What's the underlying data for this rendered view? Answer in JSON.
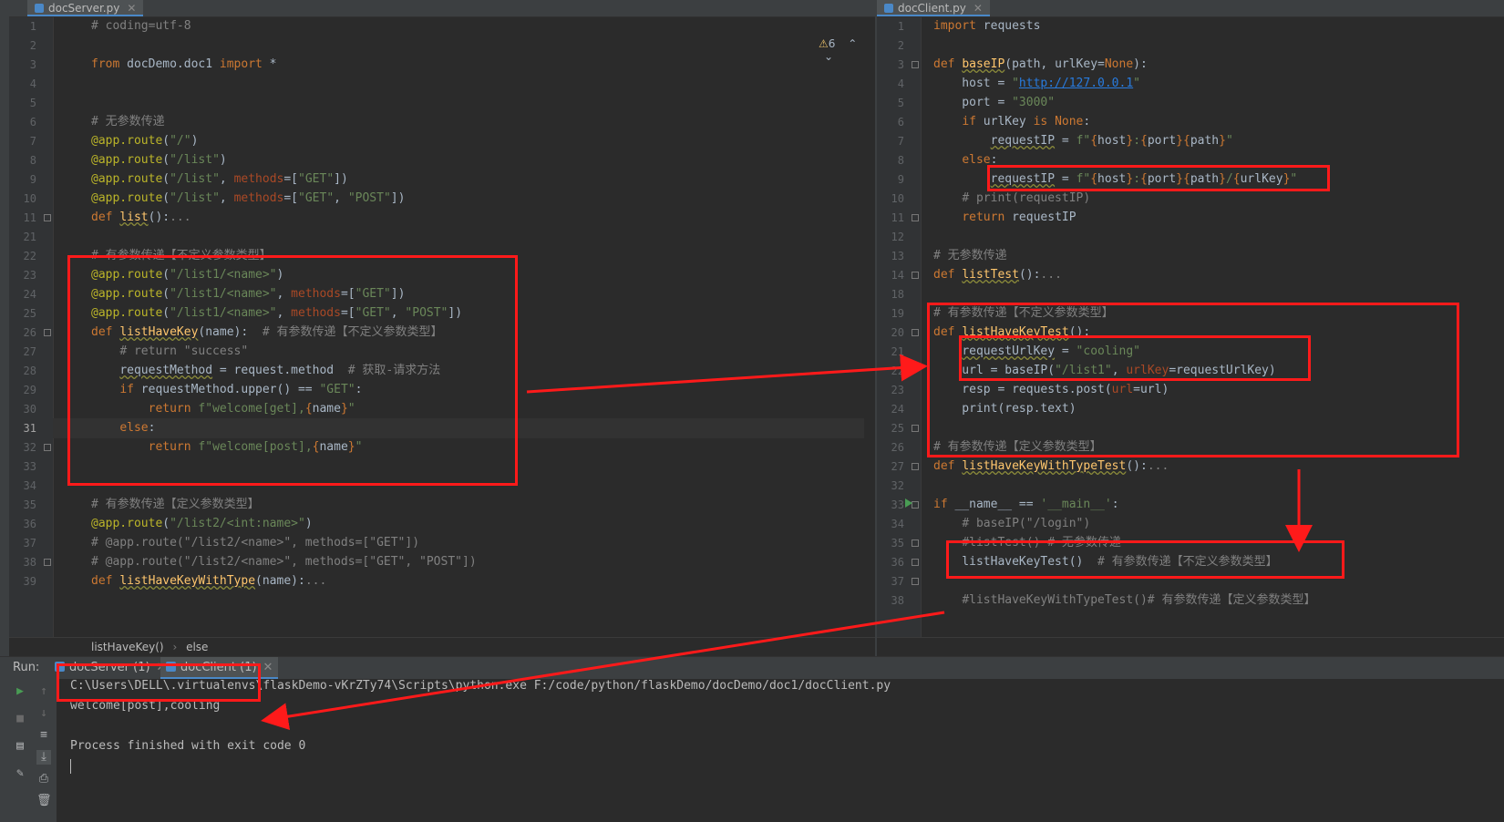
{
  "left_tab": {
    "name": "docServer.py"
  },
  "right_tab": {
    "name": "docClient.py"
  },
  "warnings": {
    "count": "6"
  },
  "left_lines": [
    {
      "n": "1",
      "code": "<span class='cm'># coding=utf-8</span>"
    },
    {
      "n": "2",
      "code": ""
    },
    {
      "n": "3",
      "code": "<span class='kw'>from</span> docDemo.doc1 <span class='kw'>import</span> *"
    },
    {
      "n": "4",
      "code": ""
    },
    {
      "n": "5",
      "code": ""
    },
    {
      "n": "6",
      "code": "<span class='cm'># 无参数传递</span>"
    },
    {
      "n": "7",
      "code": "<span class='dc'>@app.route</span>(<span class='st'>\"/\"</span>)"
    },
    {
      "n": "8",
      "code": "<span class='dc'>@app.route</span>(<span class='st'>\"/list\"</span>)"
    },
    {
      "n": "9",
      "code": "<span class='dc'>@app.route</span>(<span class='st'>\"/list\"</span>, <span class='pr'>methods</span>=[<span class='st'>\"GET\"</span>])"
    },
    {
      "n": "10",
      "code": "<span class='dc'>@app.route</span>(<span class='st'>\"/list\"</span>, <span class='pr'>methods</span>=[<span class='st'>\"GET\"</span>, <span class='st'>\"POST\"</span>])"
    },
    {
      "n": "11",
      "code": "<span class='kw'>def</span> <span class='fn sq'>list</span>():<span class='cm'>...</span>"
    },
    {
      "n": "21",
      "code": ""
    },
    {
      "n": "22",
      "code": "<span class='cm'># 有参数传递【不定义参数类型】</span>"
    },
    {
      "n": "23",
      "code": "<span class='dc'>@app.route</span>(<span class='st'>\"/list1/&lt;name&gt;\"</span>)"
    },
    {
      "n": "24",
      "code": "<span class='dc'>@app.route</span>(<span class='st'>\"/list1/&lt;name&gt;\"</span>, <span class='pr'>methods</span>=[<span class='st'>\"GET\"</span>])"
    },
    {
      "n": "25",
      "code": "<span class='dc'>@app.route</span>(<span class='st'>\"/list1/&lt;name&gt;\"</span>, <span class='pr'>methods</span>=[<span class='st'>\"GET\"</span>, <span class='st'>\"POST\"</span>])"
    },
    {
      "n": "26",
      "code": "<span class='kw'>def</span> <span class='fn sq'>listHaveKey</span>(name):  <span class='cm'># 有参数传递【不定义参数类型】</span>"
    },
    {
      "n": "27",
      "code": "    <span class='cm'># return \"success\"</span>"
    },
    {
      "n": "28",
      "code": "    <span class='sq'>requestMethod</span> = request.method  <span class='cm'># 获取-请求方法</span>"
    },
    {
      "n": "29",
      "code": "    <span class='kw'>if</span> requestMethod.upper() == <span class='st'>\"GET\"</span>:"
    },
    {
      "n": "30",
      "code": "        <span class='kw'>return</span> <span class='st'>f\"welcome[get],</span><span class='kw'>{</span>name<span class='kw'>}</span><span class='st'>\"</span>"
    },
    {
      "n": "31",
      "code": "    <span class='kw'>else</span>:"
    },
    {
      "n": "32",
      "code": "        <span class='kw'>return</span> <span class='st'>f\"welcome[post],</span><span class='kw'>{</span>name<span class='kw'>}</span><span class='st'>\"</span>"
    },
    {
      "n": "33",
      "code": ""
    },
    {
      "n": "34",
      "code": ""
    },
    {
      "n": "35",
      "code": "<span class='cm'># 有参数传递【定义参数类型】</span>"
    },
    {
      "n": "36",
      "code": "<span class='dc'>@app.route</span>(<span class='st'>\"/list2/&lt;int:name&gt;\"</span>)"
    },
    {
      "n": "37",
      "code": "<span class='cm'># @app.route(\"/list2/&lt;name&gt;\", methods=[\"GET\"])</span>"
    },
    {
      "n": "38",
      "code": "<span class='cm'># @app.route(\"/list2/&lt;name&gt;\", methods=[\"GET\", \"POST\"])</span>"
    },
    {
      "n": "39",
      "code": "<span class='kw'>def</span> <span class='fn sq'>listHaveKeyWithType</span>(name):<span class='cm'>...</span>"
    }
  ],
  "right_lines": [
    {
      "n": "1",
      "code": "<span class='kw'>import</span> requests"
    },
    {
      "n": "2",
      "code": ""
    },
    {
      "n": "3",
      "code": "<span class='kw'>def</span> <span class='fn sq'>baseIP</span>(path, urlKey=<span class='kw'>None</span>):"
    },
    {
      "n": "4",
      "code": "    host = <span class='st'>\"</span><span class='ur'>http://127.0.0.1</span><span class='st'>\"</span>"
    },
    {
      "n": "5",
      "code": "    port = <span class='st'>\"3000\"</span>"
    },
    {
      "n": "6",
      "code": "    <span class='kw'>if</span> urlKey <span class='kw'>is None</span>:"
    },
    {
      "n": "7",
      "code": "        <span class='sq'>requestIP</span> = <span class='st'>f\"</span><span class='kw'>{</span>host<span class='kw'>}</span><span class='st'>:</span><span class='kw'>{</span>port<span class='kw'>}{</span>path<span class='kw'>}</span><span class='st'>\"</span>"
    },
    {
      "n": "8",
      "code": "    <span class='kw'>else</span>:"
    },
    {
      "n": "9",
      "code": "        <span class='sq'>requestIP</span> = <span class='st'>f\"</span><span class='kw'>{</span>host<span class='kw'>}</span><span class='st'>:</span><span class='kw'>{</span>port<span class='kw'>}{</span>path<span class='kw'>}</span><span class='st'>/</span><span class='kw'>{</span>urlKey<span class='kw'>}</span><span class='st'>\"</span>"
    },
    {
      "n": "10",
      "code": "    <span class='cm'># print(requestIP)</span>"
    },
    {
      "n": "11",
      "code": "    <span class='kw'>return</span> requestIP"
    },
    {
      "n": "12",
      "code": ""
    },
    {
      "n": "13",
      "code": "<span class='cm'># 无参数传递</span>"
    },
    {
      "n": "14",
      "code": "<span class='kw'>def</span> <span class='fn sq'>listTest</span>():<span class='cm'>...</span>"
    },
    {
      "n": "18",
      "code": ""
    },
    {
      "n": "19",
      "code": "<span class='cm'># 有参数传递【不定义参数类型】</span>"
    },
    {
      "n": "20",
      "code": "<span class='kw'>def</span> <span class='fn sq'>listHaveKeyTest</span>():"
    },
    {
      "n": "21",
      "code": "    <span class='sq'>requestUrlKey</span> = <span class='st'>\"cooling\"</span>"
    },
    {
      "n": "22",
      "code": "    url = baseIP(<span class='st'>\"/list1\"</span>, <span class='pr'>urlKey</span>=requestUrlKey)"
    },
    {
      "n": "23",
      "code": "    resp = requests.post(<span class='pr'>url</span>=url)"
    },
    {
      "n": "24",
      "code": "    print(resp.text)"
    },
    {
      "n": "25",
      "code": ""
    },
    {
      "n": "26",
      "code": "<span class='cm'># 有参数传递【定义参数类型】</span>"
    },
    {
      "n": "27",
      "code": "<span class='kw'>def</span> <span class='fn sq'>listHaveKeyWithTypeTest</span>():<span class='cm'>...</span>"
    },
    {
      "n": "32",
      "code": ""
    },
    {
      "n": "33",
      "code": "<span class='kw'>if</span> __name__ == <span class='st'>'__main__'</span>:"
    },
    {
      "n": "34",
      "code": "    <span class='cm'># baseIP(\"/login\")</span>"
    },
    {
      "n": "35",
      "code": "    <span class='cm'>#listTest() # 无参数传递</span>"
    },
    {
      "n": "36",
      "code": "    listHaveKeyTest()  <span class='cm'># 有参数传递【不定义参数类型】</span>"
    },
    {
      "n": "37",
      "code": ""
    },
    {
      "n": "38",
      "code": "    <span class='cm'>#listHaveKeyWithTypeTest()# 有参数传递【定义参数类型】</span>"
    }
  ],
  "breadcrumb": {
    "func": "listHaveKey()",
    "sep": "›",
    "branch": "else"
  },
  "run_panel": {
    "label": "Run:",
    "tabs": [
      {
        "name": "docServer (1)"
      },
      {
        "name": "docClient (1)"
      }
    ]
  },
  "console_lines": [
    "C:\\Users\\DELL\\.virtualenvs\\flaskDemo-vKrZTy74\\Scripts\\python.exe F:/code/python/flaskDemo/docDemo/doc1/docClient.py",
    "welcome[post],cooling",
    "",
    "Process finished with exit code 0"
  ],
  "colors": {
    "annotation": "#ff1a1a",
    "keyword": "#cc7832",
    "string": "#6a8759",
    "comment": "#808080",
    "decorator": "#bbb529",
    "function": "#ffc66d"
  }
}
